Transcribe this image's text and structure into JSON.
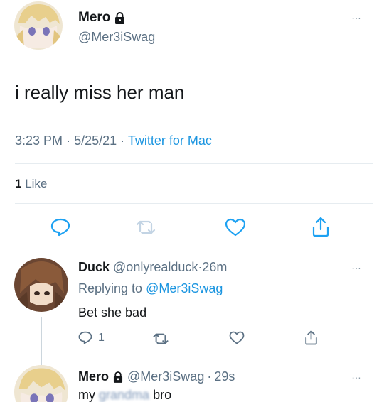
{
  "main_tweet": {
    "display_name": "Mero",
    "handle": "@Mer3iSwag",
    "text": "i really miss her man",
    "time": "3:23 PM",
    "date": "5/25/21",
    "source": "Twitter for Mac",
    "likes_count": "1",
    "likes_label": "Like",
    "more_label": "…"
  },
  "reply": {
    "display_name": "Duck",
    "handle": "@onlyrealduck",
    "age": "26m",
    "replying_prefix": "Replying to",
    "replying_to": "@Mer3iSwag",
    "text": "Bet she bad",
    "reply_count": "1",
    "more_label": "…"
  },
  "reply2": {
    "display_name": "Mero",
    "handle": "@Mer3iSwag",
    "age": "29s",
    "text_start": "my",
    "text_blurred": "grandma",
    "text_end": "bro",
    "more_label": "…"
  },
  "separator": "·",
  "icons": {
    "lock": "lock-icon",
    "reply": "reply-icon",
    "retweet": "retweet-icon",
    "like": "heart-icon",
    "share": "share-icon"
  },
  "colors": {
    "link_blue": "#1b95e0",
    "muted": "#5b7083",
    "divider": "#e6ecf0",
    "icon_blue": "#1da1f2",
    "icon_gray": "#5b7083"
  }
}
